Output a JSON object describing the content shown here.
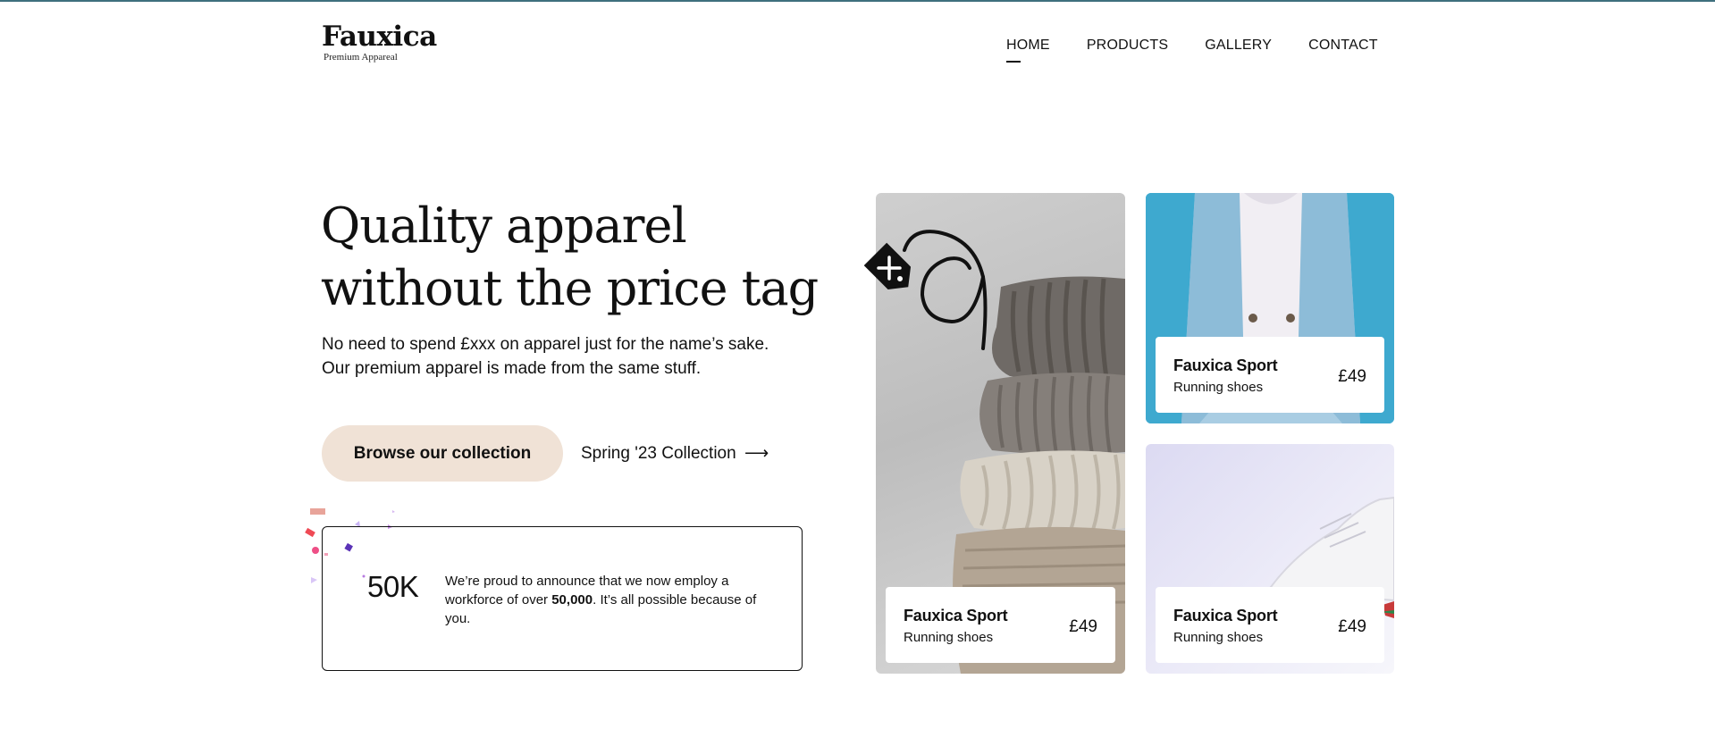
{
  "brand": {
    "name": "Fauxica",
    "tagline": "Premium Appareal"
  },
  "nav": {
    "items": [
      "HOME",
      "PRODUCTS",
      "GALLERY",
      "CONTACT"
    ],
    "active": "HOME"
  },
  "hero": {
    "title_line1": "Quality apparel",
    "title_line2": "without the price tag",
    "subtitle_line1": "No need to spend £xxx on apparel just for the name’s sake.",
    "subtitle_line2": "Our premium apparel is made from the same stuff.",
    "primary_cta": "Browse our collection",
    "secondary_cta": "Spring '23 Collection",
    "secondary_cta_arrow": "⟶"
  },
  "stat": {
    "value": "50K",
    "text_before": "We’re proud to announce that we now employ a workforce of over ",
    "text_bold": "50,000",
    "text_after": ". It’s all possible because of you."
  },
  "products": [
    {
      "title": "Fauxica Sport",
      "subtitle": "Running shoes",
      "price": "£49",
      "image": "folded-sweaters"
    },
    {
      "title": "Fauxica Sport",
      "subtitle": "Running shoes",
      "price": "£49",
      "image": "denim-jacket"
    },
    {
      "title": "Fauxica Sport",
      "subtitle": "Running shoes",
      "price": "£49",
      "image": "white-sneaker"
    }
  ],
  "colors": {
    "accent_cta": "#f0e2d6",
    "top_border": "#3f6f7d",
    "jacket_bg": "#3ea9cf",
    "shoe_bg": "#dcdaf2"
  },
  "icons": {
    "price_tag": "price-tag-icon",
    "arrow": "arrow-right-icon"
  }
}
